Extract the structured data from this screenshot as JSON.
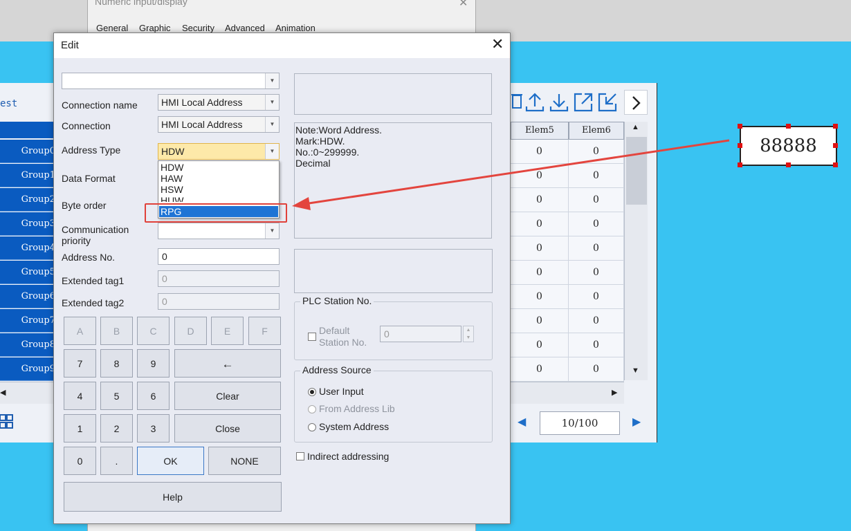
{
  "back_dialog": {
    "title": "Numeric input/display",
    "close": "✕",
    "tabs": [
      "General",
      "Graphic",
      "Security",
      "Advanced",
      "Animation"
    ]
  },
  "left_table": {
    "header": "est",
    "groups": [
      "Group0",
      "Group1",
      "Group2",
      "Group3",
      "Group4",
      "Group5",
      "Group6",
      "Group7",
      "Group8",
      "Group9"
    ]
  },
  "right_table": {
    "toolbar_icons": [
      "trash-icon",
      "upload-icon",
      "download-icon",
      "export-icon",
      "import-icon",
      "next-icon"
    ],
    "columns": [
      "Elem5",
      "Elem6"
    ],
    "rows": [
      [
        "0",
        "0"
      ],
      [
        "0",
        "0"
      ],
      [
        "0",
        "0"
      ],
      [
        "0",
        "0"
      ],
      [
        "0",
        "0"
      ],
      [
        "0",
        "0"
      ],
      [
        "0",
        "0"
      ],
      [
        "0",
        "0"
      ],
      [
        "0",
        "0"
      ],
      [
        "0",
        "0"
      ]
    ],
    "page": "10/100"
  },
  "canvas_element": {
    "value": "88888"
  },
  "edit": {
    "title": "Edit",
    "close": "✕",
    "top_combo": "",
    "labels": {
      "connection_name": "Connection name",
      "connection": "Connection",
      "address_type": "Address Type",
      "data_format": "Data Format",
      "byte_order": "Byte order",
      "comm_priority_1": "Communication",
      "comm_priority_2": "priority",
      "address_no": "Address No.",
      "ext_tag1": "Extended tag1",
      "ext_tag2": "Extended tag2"
    },
    "connection_name_value": "HMI Local Address",
    "connection_value": "HMI Local Address",
    "address_type_value": "HDW",
    "address_type_options": [
      "HDW",
      "HAW",
      "HSW",
      "HUW",
      "RPG"
    ],
    "address_type_highlighted": "RPG",
    "address_no_value": "0",
    "ext_tag1_value": "0",
    "ext_tag2_value": "0",
    "keypad": {
      "hex": [
        "A",
        "B",
        "C",
        "D",
        "E",
        "F"
      ],
      "r1": [
        "7",
        "8",
        "9"
      ],
      "backspace": "←",
      "r2": [
        "4",
        "5",
        "6"
      ],
      "clear": "Clear",
      "r3": [
        "1",
        "2",
        "3"
      ],
      "close": "Close",
      "zero": "0",
      "dot": ".",
      "ok": "OK",
      "none": "NONE",
      "help": "Help"
    },
    "note": [
      "Note:Word Address.",
      "Mark:HDW.",
      "No.:0~299999.",
      "Decimal"
    ],
    "plc_station": {
      "title": "PLC Station No.",
      "default_1": "Default",
      "default_2": "Station No.",
      "value": "0"
    },
    "address_source": {
      "title": "Address Source",
      "options": [
        "User Input",
        "From Address Lib",
        "System Address"
      ],
      "selected": "User Input"
    },
    "indirect": "Indirect addressing"
  },
  "colors": {
    "canvas": "#39c3f2",
    "accent": "#1f74d5",
    "highlight": "#e0413a",
    "combo_active": "#fde9a9"
  }
}
